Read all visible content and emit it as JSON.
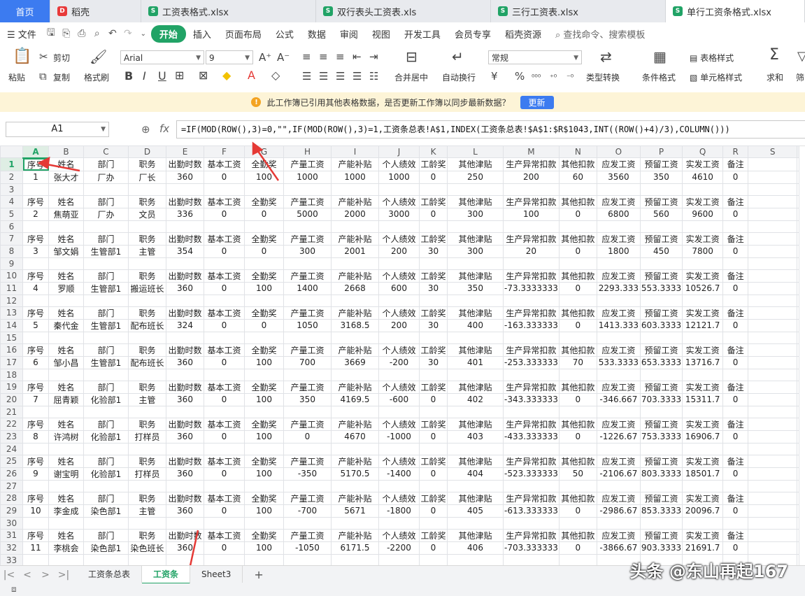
{
  "tabs": [
    {
      "label": "首页",
      "kind": "home"
    },
    {
      "label": "稻壳",
      "kind": "docer"
    },
    {
      "label": "工资表格式.xlsx",
      "kind": "sheet"
    },
    {
      "label": "双行表头工资表.xls",
      "kind": "sheet"
    },
    {
      "label": "三行工资表.xlsx",
      "kind": "sheet"
    },
    {
      "label": "单行工资条格式.xlsx",
      "kind": "sheet",
      "active": true
    }
  ],
  "menu": {
    "file": "文件",
    "items": [
      "开始",
      "插入",
      "页面布局",
      "公式",
      "数据",
      "审阅",
      "视图",
      "开发工具",
      "会员专享",
      "稻壳资源"
    ],
    "search": "查找命令、搜索模板"
  },
  "ribbon": {
    "paste": "粘贴",
    "cut": "剪切",
    "copy": "复制",
    "format_painter": "格式刷",
    "font": "Arial",
    "font_size": "9",
    "merge": "合并居中",
    "wrap": "自动换行",
    "number_format": "常规",
    "convert": "类型转换",
    "cond_format": "条件格式",
    "table_style": "表格样式",
    "cell_style": "单元格样式",
    "sum": "求和",
    "filter": "筛"
  },
  "notice": {
    "text": "此工作簿已引用其他表格数据，是否更新工作簿以同步最新数据？",
    "button": "更新"
  },
  "formula_bar": {
    "cell": "A1",
    "formula": "=IF(MOD(ROW(),3)=0,\"\",IF(MOD(ROW(),3)=1,工资条总表!A$1,INDEX(工资条总表!$A$1:$R$1043,INT((ROW()+4)/3),COLUMN()))"
  },
  "columns": [
    "A",
    "B",
    "C",
    "D",
    "E",
    "F",
    "G",
    "H",
    "I",
    "J",
    "K",
    "L",
    "M",
    "N",
    "O",
    "P",
    "Q",
    "R",
    "S"
  ],
  "headers": [
    "序号",
    "姓名",
    "部门",
    "职务",
    "出勤时数",
    "基本工资",
    "全勤奖",
    "产量工资",
    "产能补贴",
    "个人绩效",
    "工龄奖",
    "其他津贴",
    "生产异常扣款",
    "其他扣款",
    "应发工资",
    "预留工资",
    "实发工资",
    "备注"
  ],
  "records": [
    [
      "1",
      "张大才",
      "厂办",
      "厂长",
      "360",
      "0",
      "100",
      "1000",
      "1000",
      "1000",
      "0",
      "250",
      "200",
      "60",
      "3560",
      "350",
      "4610",
      "0"
    ],
    [
      "2",
      "焦萌亚",
      "厂办",
      "文员",
      "336",
      "0",
      "0",
      "5000",
      "2000",
      "3000",
      "0",
      "300",
      "100",
      "0",
      "6800",
      "560",
      "9600",
      "0"
    ],
    [
      "3",
      "邹文娟",
      "生管部1",
      "主管",
      "354",
      "0",
      "0",
      "300",
      "2001",
      "200",
      "30",
      "300",
      "20",
      "0",
      "1800",
      "450",
      "7800",
      "0"
    ],
    [
      "4",
      "罗顺",
      "生管部1",
      "搬运班长",
      "360",
      "0",
      "100",
      "1400",
      "2668",
      "600",
      "30",
      "350",
      "-73.3333333",
      "0",
      "2293.333",
      "553.3333",
      "10526.7",
      "0"
    ],
    [
      "5",
      "秦代金",
      "生管部1",
      "配布班长",
      "324",
      "0",
      "0",
      "1050",
      "3168.5",
      "200",
      "30",
      "400",
      "-163.333333",
      "0",
      "1413.333",
      "603.3333",
      "12121.7",
      "0"
    ],
    [
      "6",
      "邹小昌",
      "生管部1",
      "配布班长",
      "360",
      "0",
      "100",
      "700",
      "3669",
      "-200",
      "30",
      "401",
      "-253.333333",
      "70",
      "533.3333",
      "653.3333",
      "13716.7",
      "0"
    ],
    [
      "7",
      "屈青颖",
      "化验部1",
      "主管",
      "360",
      "0",
      "100",
      "350",
      "4169.5",
      "-600",
      "0",
      "402",
      "-343.333333",
      "0",
      "-346.667",
      "703.3333",
      "15311.7",
      "0"
    ],
    [
      "8",
      "许鸿树",
      "化验部1",
      "打样员",
      "360",
      "0",
      "100",
      "0",
      "4670",
      "-1000",
      "0",
      "403",
      "-433.333333",
      "0",
      "-1226.67",
      "753.3333",
      "16906.7",
      "0"
    ],
    [
      "9",
      "谢宝明",
      "化验部1",
      "打样员",
      "360",
      "0",
      "100",
      "-350",
      "5170.5",
      "-1400",
      "0",
      "404",
      "-523.333333",
      "50",
      "-2106.67",
      "803.3333",
      "18501.7",
      "0"
    ],
    [
      "10",
      "李金成",
      "染色部1",
      "主管",
      "360",
      "0",
      "100",
      "-700",
      "5671",
      "-1800",
      "0",
      "405",
      "-613.333333",
      "0",
      "-2986.67",
      "853.3333",
      "20096.7",
      "0"
    ],
    [
      "11",
      "李桃会",
      "染色部1",
      "染色班长",
      "360",
      "0",
      "100",
      "-1050",
      "6171.5",
      "-2200",
      "0",
      "406",
      "-703.333333",
      "0",
      "-3866.67",
      "903.3333",
      "21691.7",
      "0"
    ]
  ],
  "sheet_tabs": [
    "工资条总表",
    "工资条",
    "Sheet3"
  ],
  "active_sheet": "工资条",
  "watermark": "头条 @东山再起167",
  "colors": {
    "accent": "#21a366",
    "brand_blue": "#3c7bf0",
    "arrow": "#e53935",
    "notice_bg": "#fdf4d7"
  }
}
